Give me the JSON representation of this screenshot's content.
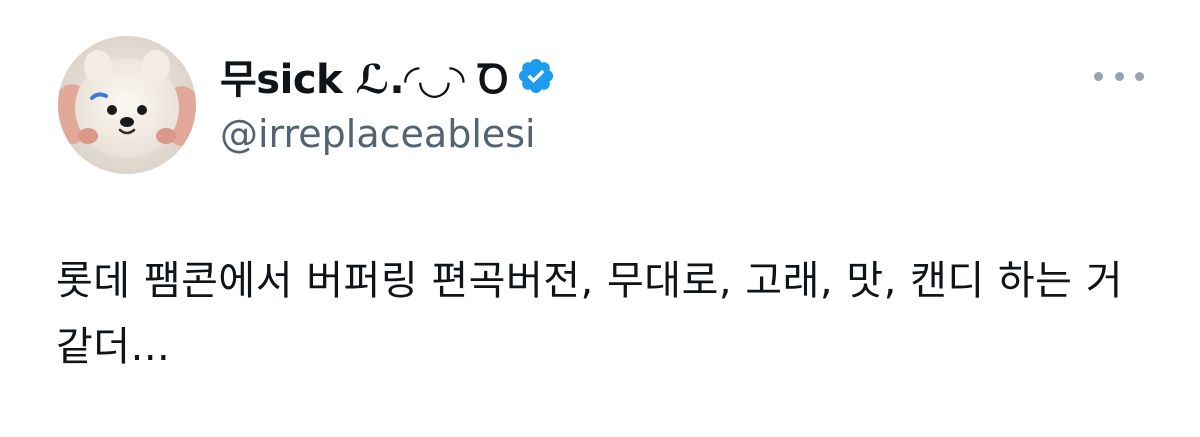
{
  "author": {
    "display_name": "무sick ℒ.◜◡◝ Ꝺ",
    "handle": "@irreplaceablesi",
    "verified": true,
    "avatar_icon": "dog-avatar-icon",
    "verified_icon": "verified-badge-icon"
  },
  "actions": {
    "more_icon": "more-options-icon"
  },
  "tweet": {
    "text": "롯데 팸콘에서 버퍼링 편곡버전, 무대로, 고래, 맛, 캔디 하는 거 같더..."
  },
  "colors": {
    "text_primary": "#0f1419",
    "text_secondary": "#536471",
    "verified_blue": "#1d9bf0",
    "more_dots": "#9aa3ab"
  }
}
